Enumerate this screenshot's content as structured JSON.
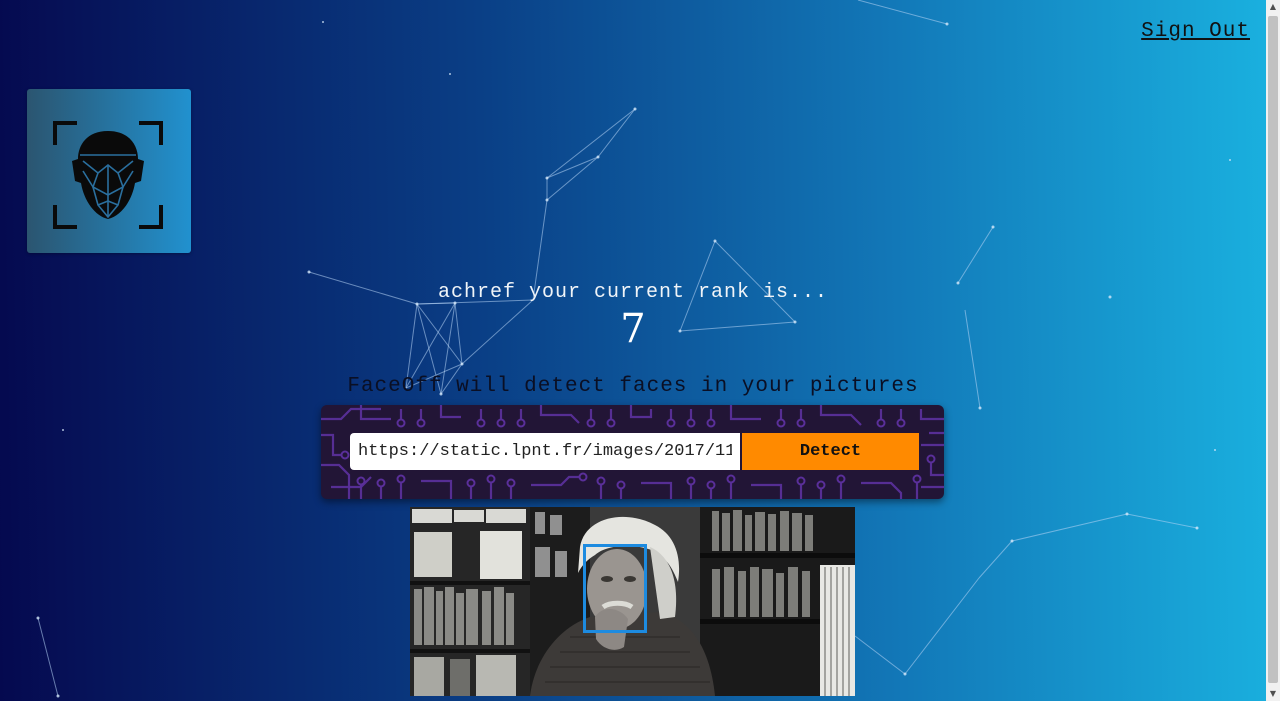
{
  "header": {
    "sign_out_label": "Sign Out"
  },
  "logo": {
    "icon": "face-recognition-icon",
    "background": "#2191cf"
  },
  "rank": {
    "text": "achref your current rank is...",
    "value": "7"
  },
  "detector": {
    "subtitle": "FaceOff will detect faces in your pictures",
    "url_value": "https://static.lpnt.fr/images/2017/11/",
    "detect_label": "Detect"
  },
  "result": {
    "image": "detected-photo",
    "faces_detected": 1,
    "box_color": "#1d8be0"
  },
  "colors": {
    "accent": "#ff8a00",
    "gradient_start": "#05094f",
    "gradient_end": "#1ab2e0"
  }
}
